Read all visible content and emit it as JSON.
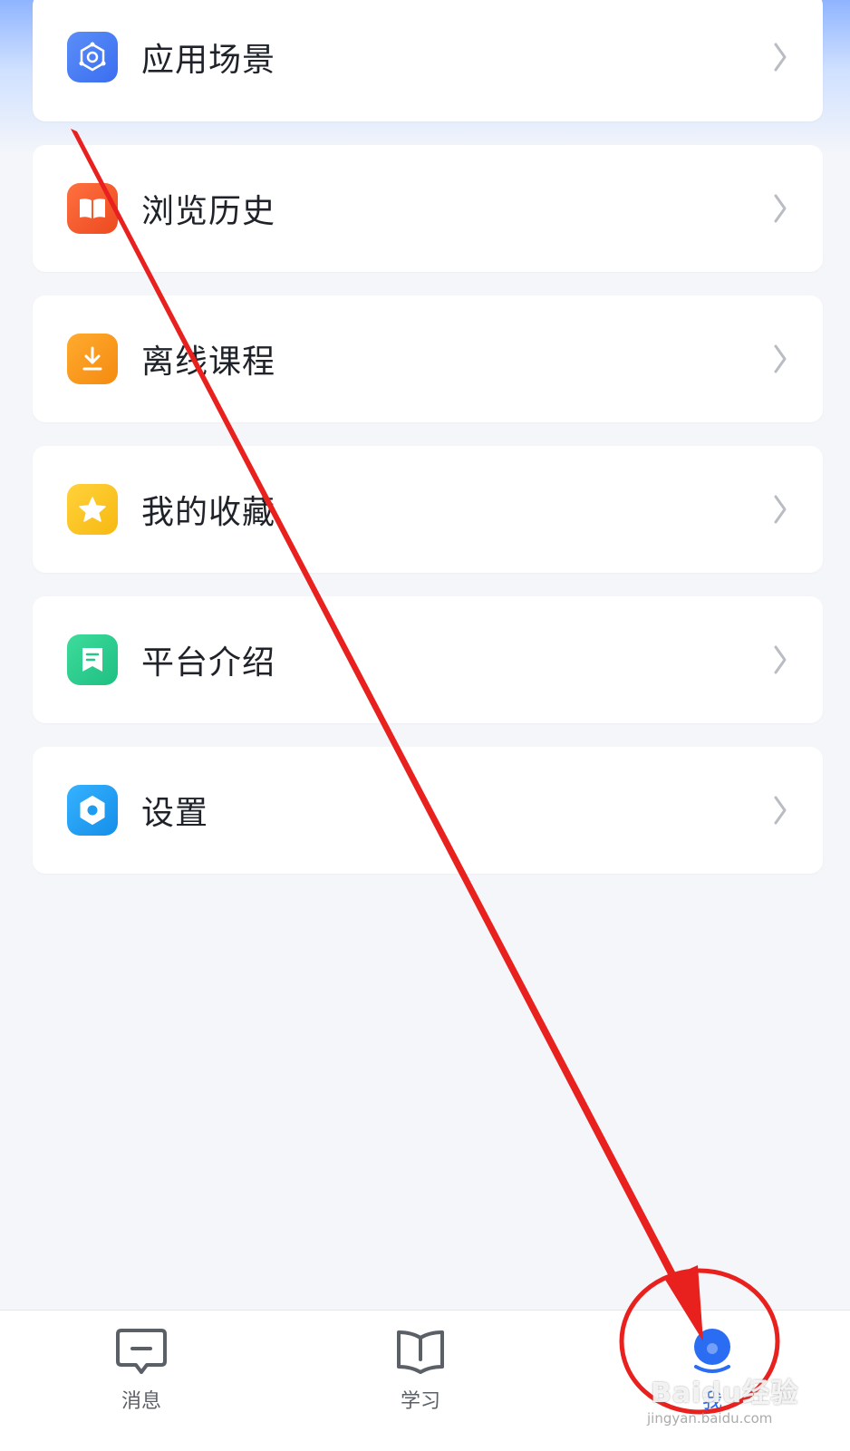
{
  "menu": {
    "items": [
      {
        "label": "应用场景",
        "icon": "nodes-icon",
        "color": "#3e7bf4"
      },
      {
        "label": "浏览历史",
        "icon": "book-icon",
        "color": "#f05a28"
      },
      {
        "label": "离线课程",
        "icon": "download-icon",
        "color": "#f79a1c"
      },
      {
        "label": "我的收藏",
        "icon": "star-icon",
        "color": "#f7c51f"
      },
      {
        "label": "平台介绍",
        "icon": "document-icon",
        "color": "#27c58a"
      },
      {
        "label": "设置",
        "icon": "gear-icon",
        "color": "#1f9cf0"
      }
    ]
  },
  "tabbar": {
    "tabs": [
      {
        "label": "消息",
        "icon": "message-icon",
        "active": false
      },
      {
        "label": "学习",
        "icon": "open-book-icon",
        "active": false
      },
      {
        "label": "我",
        "icon": "profile-icon",
        "active": true
      }
    ]
  },
  "colors": {
    "accent": "#2a6cf2",
    "annotation": "#e8211e",
    "background": "#f4f6fa"
  },
  "watermark": {
    "brand": "Baidu经验",
    "url": "jingyan.baidu.com"
  }
}
